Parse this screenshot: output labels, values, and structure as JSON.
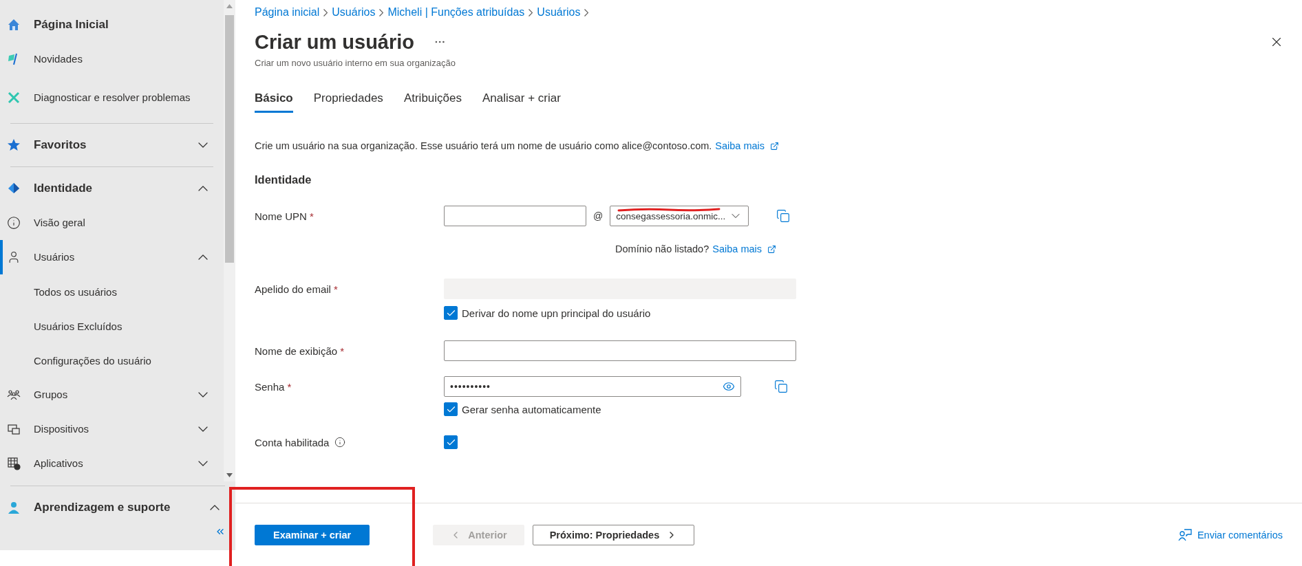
{
  "sidebar": {
    "groups": [
      {
        "items": [
          {
            "kind": "heading",
            "label": "Página Inicial",
            "selected": false
          },
          {
            "kind": "link",
            "label": "Novidades",
            "selected": false
          },
          {
            "kind": "link",
            "label": "Diagnosticar e resolver problemas",
            "selected": false
          }
        ]
      },
      {
        "items": [
          {
            "kind": "section",
            "label": "Favoritos",
            "expanded": false
          }
        ]
      },
      {
        "items": [
          {
            "kind": "section",
            "label": "Identidade",
            "expanded": true
          },
          {
            "kind": "link",
            "label": "Visão geral",
            "selected": false
          },
          {
            "kind": "link",
            "label": "Usuários",
            "selected": true,
            "expanded": true,
            "children": [
              {
                "label": "Todos os usuários",
                "selected": false
              },
              {
                "label": "Usuários Excluídos",
                "selected": false
              },
              {
                "label": "Configurações do usuário",
                "selected": false
              }
            ]
          },
          {
            "kind": "link",
            "label": "Grupos",
            "selected": false,
            "expanded": false
          },
          {
            "kind": "link",
            "label": "Dispositivos",
            "selected": false,
            "expanded": false
          },
          {
            "kind": "link",
            "label": "Aplicativos",
            "selected": false,
            "expanded": false
          }
        ]
      }
    ],
    "footer_section": {
      "kind": "section",
      "label": "Aprendizagem e suporte",
      "expanded": true
    }
  },
  "breadcrumb": [
    "Página inicial",
    "Usuários",
    "Micheli | Funções atribuídas",
    "Usuários"
  ],
  "title": "Criar um usuário",
  "subtitle": "Criar um novo usuário interno em sua organização",
  "tabs": [
    {
      "label": "Básico",
      "selected": true
    },
    {
      "label": "Propriedades",
      "selected": false
    },
    {
      "label": "Atribuições",
      "selected": false
    },
    {
      "label": "Analisar + criar",
      "selected": false
    }
  ],
  "intro": {
    "text": "Crie um usuário na sua organização. Esse usuário terá um nome de usuário como alice@contoso.com.",
    "link": "Saiba mais"
  },
  "section_title": "Identidade",
  "fields": [
    {
      "kind": "upn",
      "label": "Nome UPN",
      "required_mark": "*",
      "at": "@",
      "domain": "consegassessoria.onmic...",
      "redacted": true,
      "hint": {
        "text": "Domínio não listado?",
        "link": "Saiba mais"
      }
    },
    {
      "kind": "text",
      "label": "Apelido do email",
      "required_mark": "*",
      "disabled": true,
      "checkbox": {
        "label": "Derivar do nome upn principal do usuário",
        "checked": true
      }
    },
    {
      "kind": "text",
      "label": "Nome de exibição",
      "required_mark": "*",
      "disabled": false
    },
    {
      "kind": "password",
      "label": "Senha",
      "required_mark": "*",
      "value": "••••••••••",
      "checkbox": {
        "label": "Gerar senha automaticamente",
        "checked": true
      }
    },
    {
      "kind": "check",
      "label": "Conta habilitada",
      "checked": true
    }
  ],
  "footer": {
    "highlighted": true,
    "buttons": [
      {
        "kind": "primary",
        "label": "Examinar + criar"
      },
      {
        "kind": "back",
        "label": "Anterior",
        "disabled": true
      },
      {
        "kind": "next",
        "label": "Próximo: Propriedades",
        "disabled": false
      }
    ],
    "feedback": "Enviar comentários"
  }
}
